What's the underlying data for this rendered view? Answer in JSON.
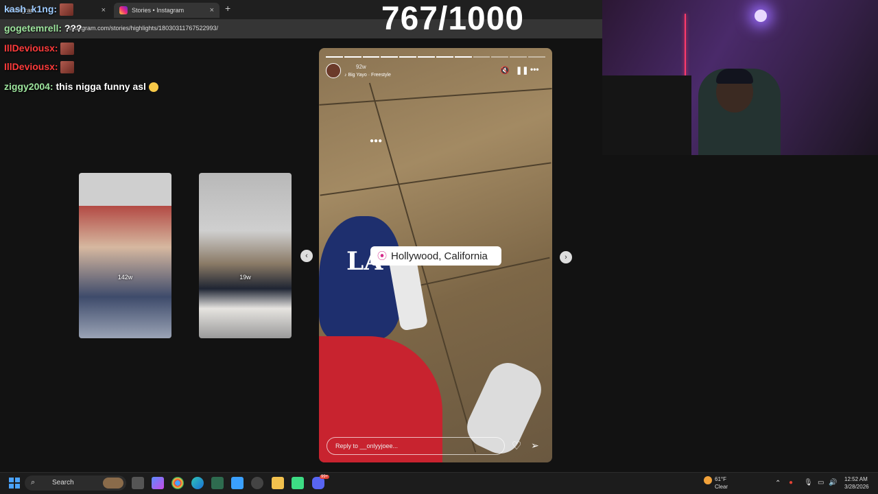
{
  "browser": {
    "tabs": [
      {
        "label": "Instagram",
        "active": false
      },
      {
        "label": "Stories • Instagram",
        "active": true
      }
    ],
    "url": "instagram.com/stories/highlights/18030311767522993/"
  },
  "overlay": {
    "counter": "767/1000"
  },
  "chat": [
    {
      "user": "kash_k1ng:",
      "color": "#9ecbff",
      "text": ""
    },
    {
      "user": "gogetemrell:",
      "color": "#9ee69e",
      "text": "???"
    },
    {
      "user": "IllDeviousx:",
      "color": "#ff3b3b",
      "text": ""
    },
    {
      "user": "IllDeviousx:",
      "color": "#ff3b3b",
      "text": ""
    },
    {
      "user": "ziggy2004:",
      "color": "#9ee69e",
      "text": "this nigga funny asl"
    }
  ],
  "thumbnails": [
    {
      "ago": "142w"
    },
    {
      "ago": "19w"
    }
  ],
  "story": {
    "time": "92w",
    "music": "Big Yayo · Freestyle",
    "location": "Hollywood, California",
    "reply_placeholder": "Reply to __onlyyjoee...",
    "progress_segments_total": 12,
    "progress_segments_done": 8
  },
  "taskbar": {
    "search_label": "Search",
    "weather_temp": "61°F",
    "weather_desc": "Clear",
    "time": "12:52 AM",
    "date": "3/28/2026",
    "notif_badge": "99+"
  },
  "colors": {
    "accent": "#ee2a7b",
    "taskbar": "#1c1c1c"
  }
}
